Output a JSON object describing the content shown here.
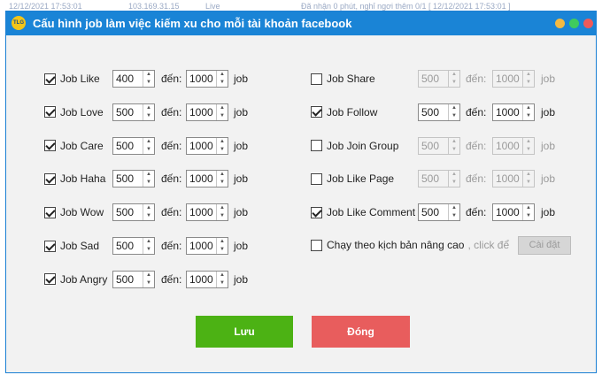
{
  "background": {
    "rows": [
      "12/12/2021 17:53:01",
      "103.169.31.15",
      "Live",
      "Đã nhận 0 phút, nghỉ ngơi thêm 0/1 [ 12/12/2021 17:53:01 ]"
    ]
  },
  "dialog": {
    "logo_text": "TLG",
    "title": "Cấu hình job làm việc kiếm xu cho mỗi tài khoản facebook",
    "colors": {
      "titlebar": "#1a84d6",
      "save": "#4cb214",
      "close": "#e85d5d"
    }
  },
  "common": {
    "to_label": "đến:",
    "unit_label": "job"
  },
  "left_jobs": [
    {
      "label": "Job Like",
      "checked": true,
      "from": "400",
      "to": "1000"
    },
    {
      "label": "Job Love",
      "checked": true,
      "from": "500",
      "to": "1000"
    },
    {
      "label": "Job Care",
      "checked": true,
      "from": "500",
      "to": "1000"
    },
    {
      "label": "Job Haha",
      "checked": true,
      "from": "500",
      "to": "1000"
    },
    {
      "label": "Job Wow",
      "checked": true,
      "from": "500",
      "to": "1000"
    },
    {
      "label": "Job Sad",
      "checked": true,
      "from": "500",
      "to": "1000"
    },
    {
      "label": "Job Angry",
      "checked": true,
      "from": "500",
      "to": "1000"
    }
  ],
  "right_jobs": [
    {
      "label": "Job Share",
      "checked": false,
      "from": "500",
      "to": "1000"
    },
    {
      "label": "Job Follow",
      "checked": true,
      "from": "500",
      "to": "1000"
    },
    {
      "label": "Job Join Group",
      "checked": false,
      "from": "500",
      "to": "1000"
    },
    {
      "label": "Job Like Page",
      "checked": false,
      "from": "500",
      "to": "1000"
    },
    {
      "label": "Job Like Comment",
      "checked": true,
      "from": "500",
      "to": "1000"
    }
  ],
  "script_option": {
    "label": "Chạy theo kịch bản nâng cao",
    "hint": ", click để",
    "checked": false,
    "button": "Cài đặt"
  },
  "buttons": {
    "save": "Lưu",
    "close": "Đóng"
  }
}
